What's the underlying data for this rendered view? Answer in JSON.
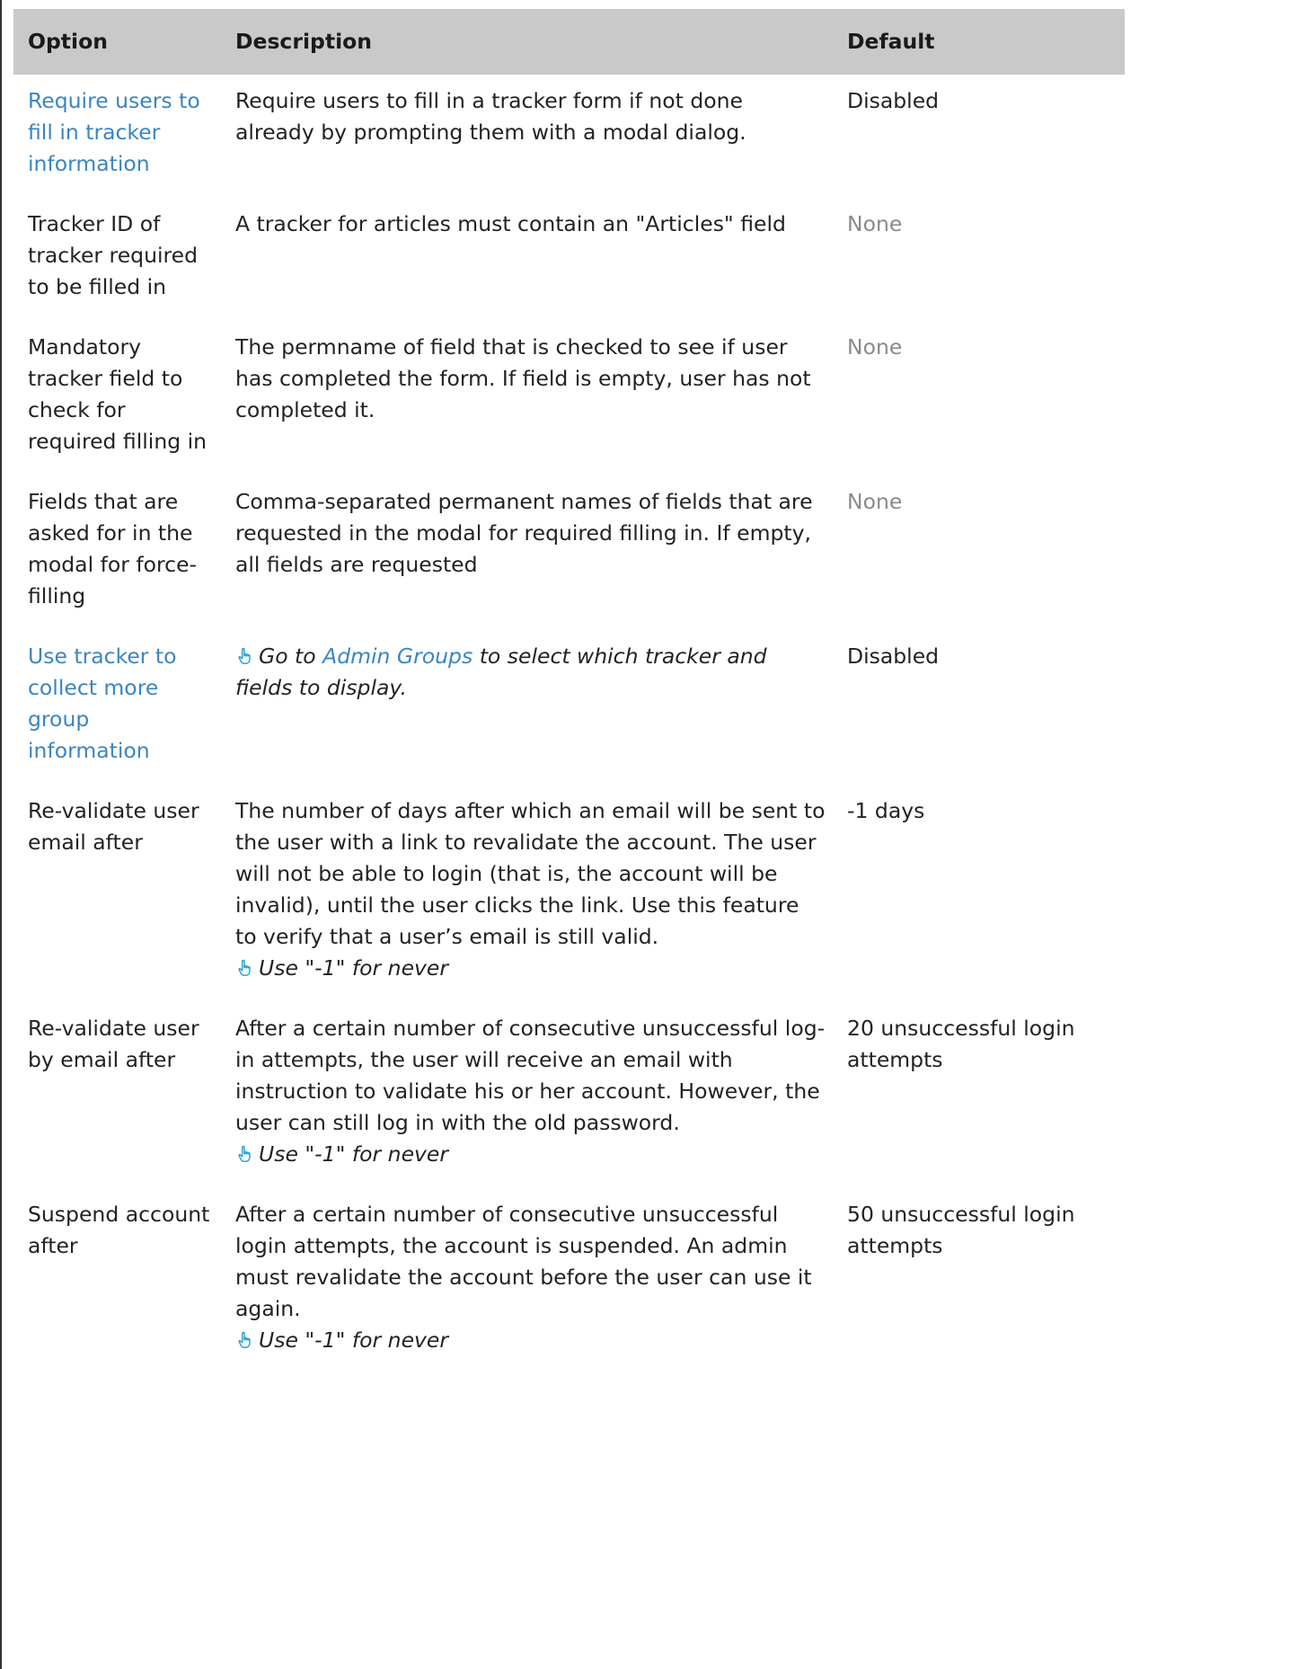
{
  "table": {
    "headers": {
      "option": "Option",
      "description": "Description",
      "default": "Default"
    },
    "rows": [
      {
        "option": "Require users to fill in tracker information",
        "option_is_link": true,
        "description": "Require users to fill in a tracker form if not done already by prompting them with a modal dialog.",
        "default": "Disabled",
        "default_muted": false
      },
      {
        "option": "Tracker ID of tracker required to be filled in",
        "option_is_link": false,
        "description": "A tracker for articles must contain an \"Articles\" field",
        "default": "None",
        "default_muted": true
      },
      {
        "option": "Mandatory tracker field to check for required filling in",
        "option_is_link": false,
        "description": "The permname of field that is checked to see if user has completed the form. If field is empty, user has not completed it.",
        "default": "None",
        "default_muted": true
      },
      {
        "option": "Fields that are asked for in the modal for force-filling",
        "option_is_link": false,
        "description": "Comma-separated permanent names of fields that are requested in the modal for required filling in. If empty, all fields are requested",
        "default": "None",
        "default_muted": true
      },
      {
        "option": "Use tracker to collect more group information",
        "option_is_link": true,
        "tip_prefix": "Go to ",
        "tip_link": "Admin Groups",
        "tip_suffix": " to select which tracker and fields to display.",
        "default": "Disabled",
        "default_muted": false
      },
      {
        "option": "Re-validate user email after",
        "option_is_link": false,
        "description": "The number of days after which an email will be sent to the user with a link to revalidate the account. The user will not be able to login (that is, the account will be invalid), until the user clicks the link. Use this feature to verify that a user’s email is still valid.",
        "tip": "Use \"-1\" for never",
        "default": "-1 days",
        "default_muted": false
      },
      {
        "option": "Re-validate user by email after",
        "option_is_link": false,
        "description": "After a certain number of consecutive unsuccessful log-in attempts, the user will receive an email with instruction to validate his or her account. However, the user can still log in with the old password.",
        "tip": "Use \"-1\" for never",
        "default": "20 unsuccessful login attempts",
        "default_muted": false
      },
      {
        "option": "Suspend account after",
        "option_is_link": false,
        "description": "After a certain number of consecutive unsuccessful login attempts, the account is suspended. An admin must revalidate the account before the user can use it again.",
        "tip": "Use \"-1\" for never",
        "default": "50 unsuccessful login attempts",
        "default_muted": false
      }
    ]
  },
  "colors": {
    "link": "#3a85c2",
    "header_bg": "#c9c9c9",
    "muted": "#8a8a8a",
    "tip_icon": "#29a3d6"
  },
  "icons": {
    "tip": "pointing-hand-icon"
  }
}
